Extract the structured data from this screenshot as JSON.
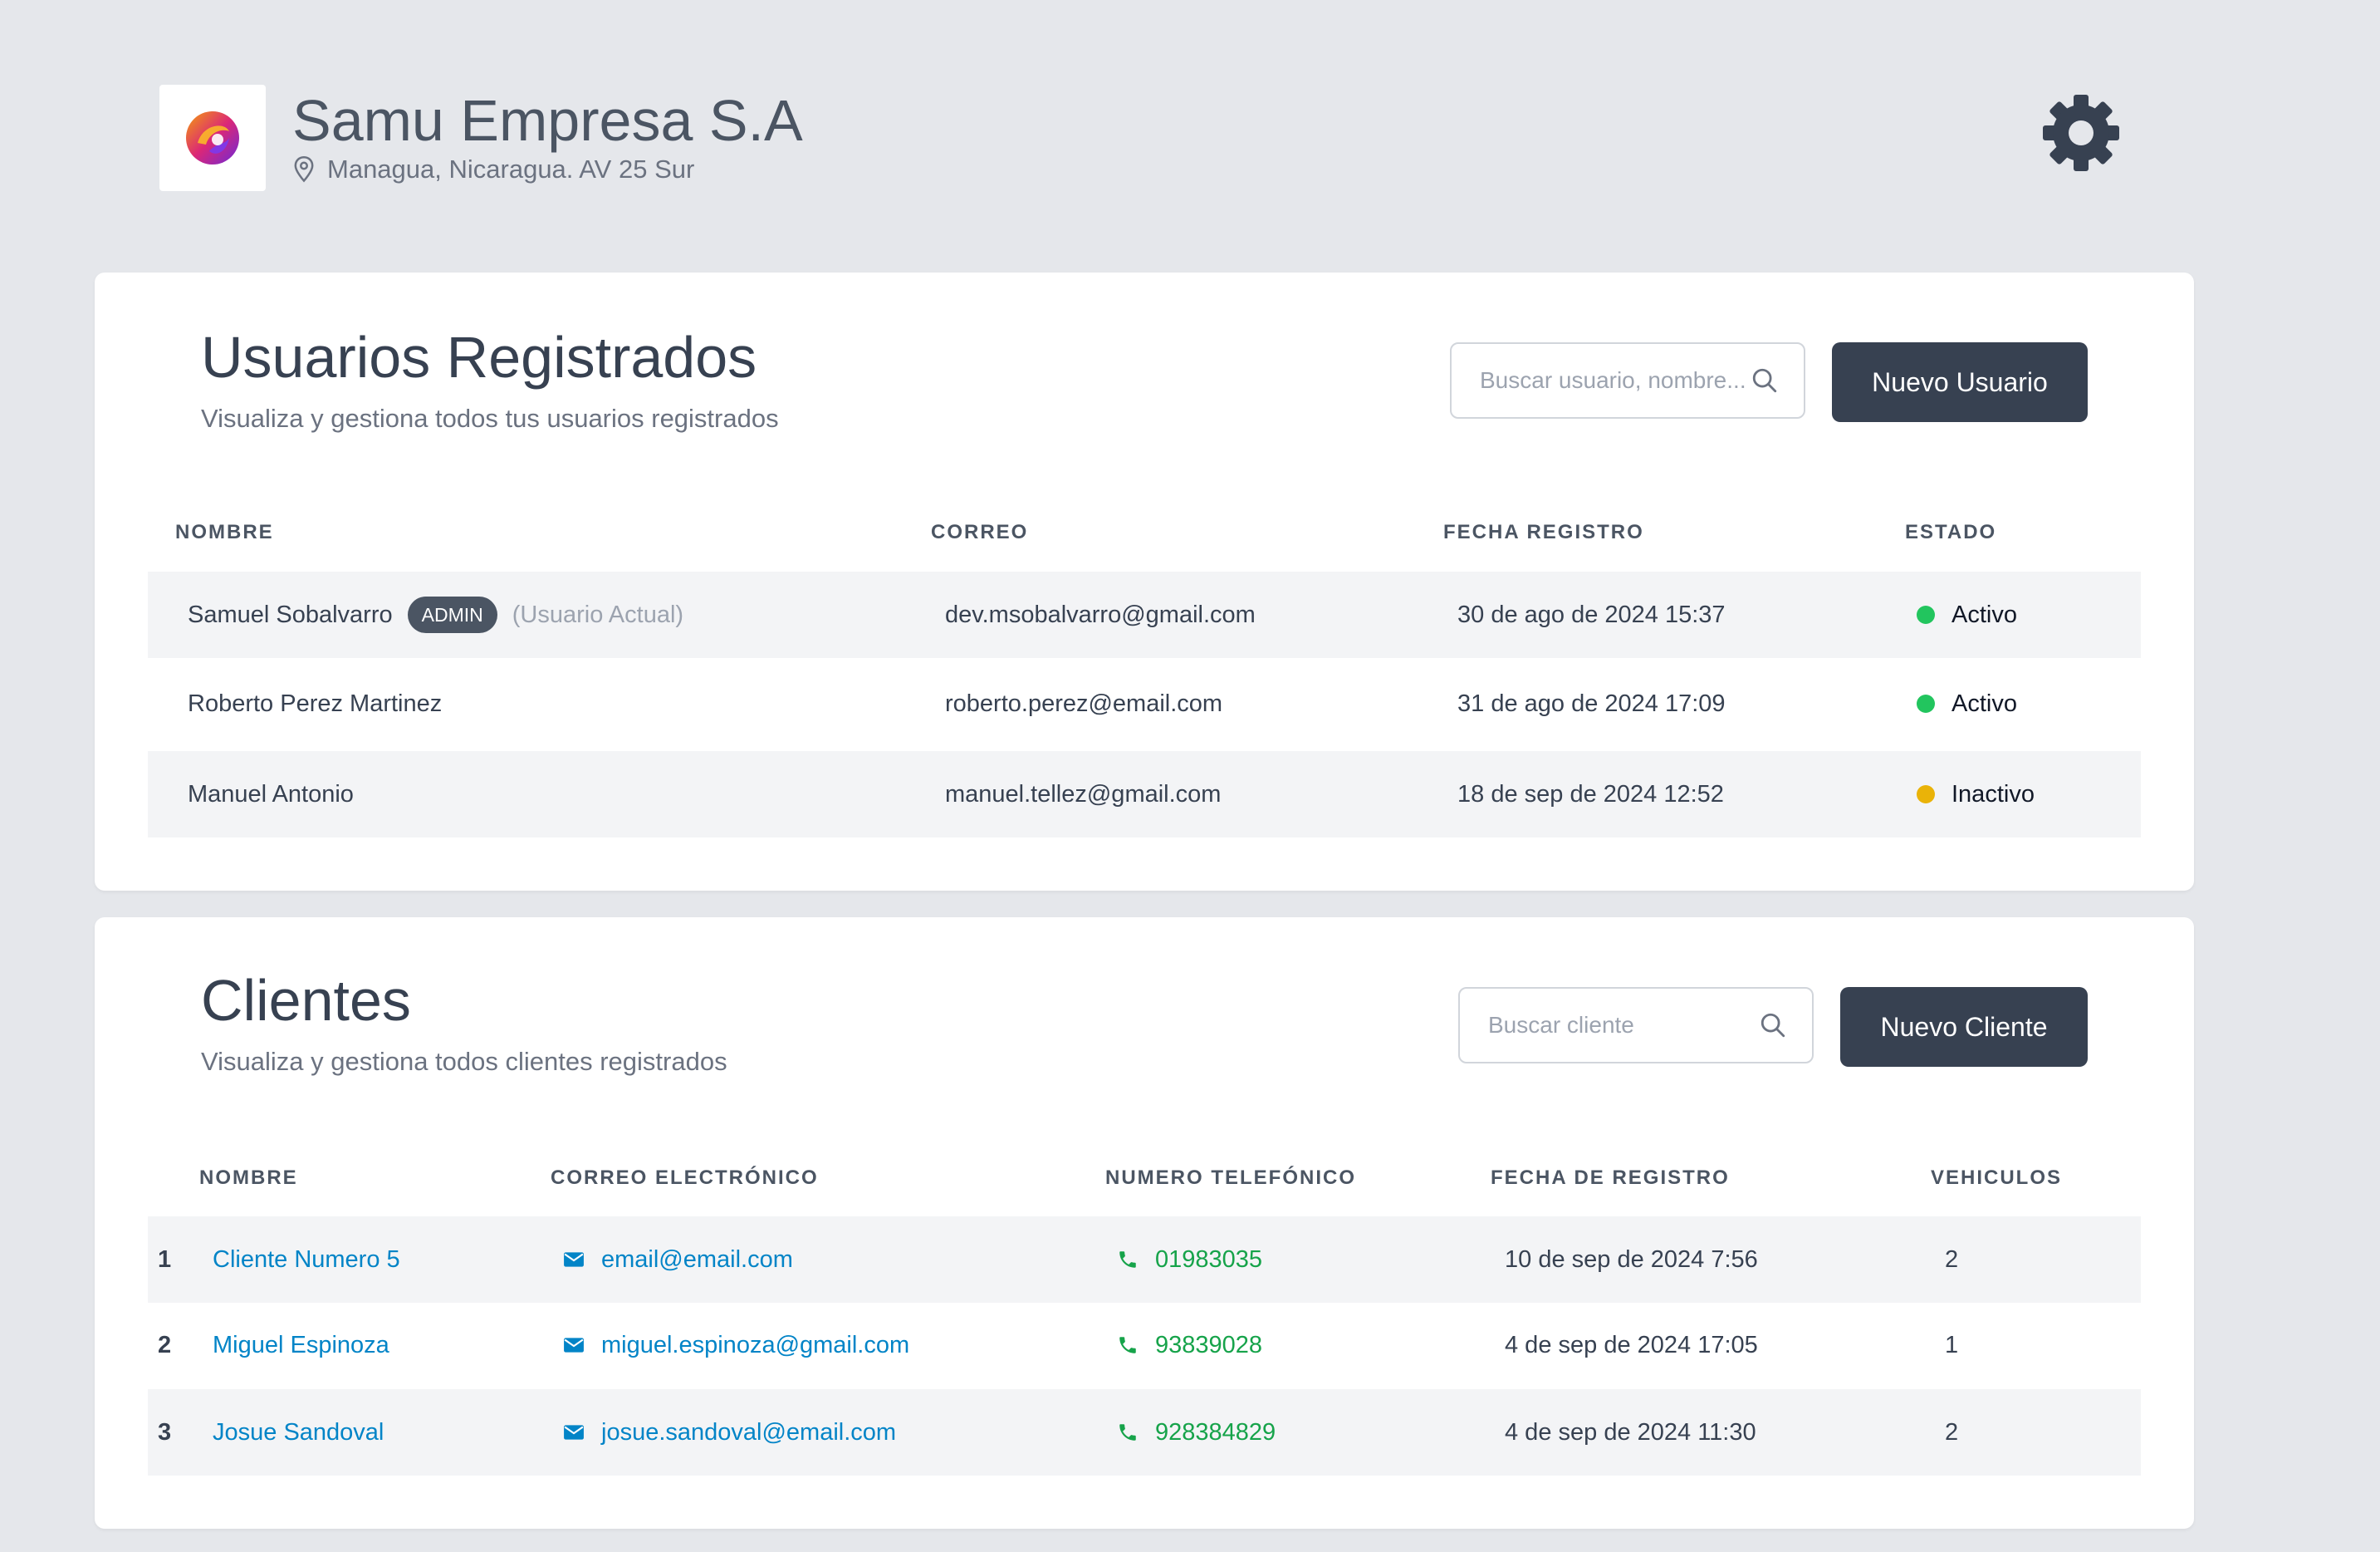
{
  "company": {
    "name": "Samu Empresa S.A",
    "location": "Managua, Nicaragua. AV 25 Sur"
  },
  "colors": {
    "primary_button": "#374151",
    "active": "#22c55e",
    "inactive": "#eab308",
    "link_blue": "#0284c7",
    "link_green": "#16a34a"
  },
  "users": {
    "title": "Usuarios Registrados",
    "subtitle": "Visualiza y gestiona todos tus usuarios registrados",
    "search_placeholder": "Buscar usuario, nombre...",
    "new_button": "Nuevo Usuario",
    "columns": [
      "NOMBRE",
      "CORREO",
      "FECHA REGISTRO",
      "ESTADO"
    ],
    "rows": [
      {
        "name": "Samuel Sobalvarro",
        "badge": "ADMIN",
        "note": "(Usuario Actual)",
        "email": "dev.msobalvarro@gmail.com",
        "date": "30 de ago de 2024 15:37",
        "status": "Activo",
        "status_color": "#22c55e"
      },
      {
        "name": "Roberto Perez Martinez",
        "email": "roberto.perez@email.com",
        "date": "31 de ago de 2024 17:09",
        "status": "Activo",
        "status_color": "#22c55e"
      },
      {
        "name": "Manuel Antonio",
        "email": "manuel.tellez@gmail.com",
        "date": "18 de sep de 2024 12:52",
        "status": "Inactivo",
        "status_color": "#eab308"
      }
    ]
  },
  "clients": {
    "title": "Clientes",
    "subtitle": "Visualiza y gestiona todos clientes registrados",
    "search_placeholder": "Buscar cliente",
    "new_button": "Nuevo Cliente",
    "columns": [
      "NOMBRE",
      "CORREO ELECTRÓNICO",
      "NUMERO TELEFÓNICO",
      "FECHA DE REGISTRO",
      "VEHICULOS"
    ],
    "rows": [
      {
        "num": "1",
        "name": "Cliente Numero 5",
        "email": "email@email.com",
        "phone": "01983035",
        "date": "10 de sep de 2024 7:56",
        "vehicles": "2"
      },
      {
        "num": "2",
        "name": "Miguel Espinoza",
        "email": "miguel.espinoza@gmail.com",
        "phone": "93839028",
        "date": "4 de sep de 2024 17:05",
        "vehicles": "1"
      },
      {
        "num": "3",
        "name": "Josue Sandoval",
        "email": "josue.sandoval@email.com",
        "phone": "928384829",
        "date": "4 de sep de 2024 11:30",
        "vehicles": "2"
      }
    ]
  }
}
